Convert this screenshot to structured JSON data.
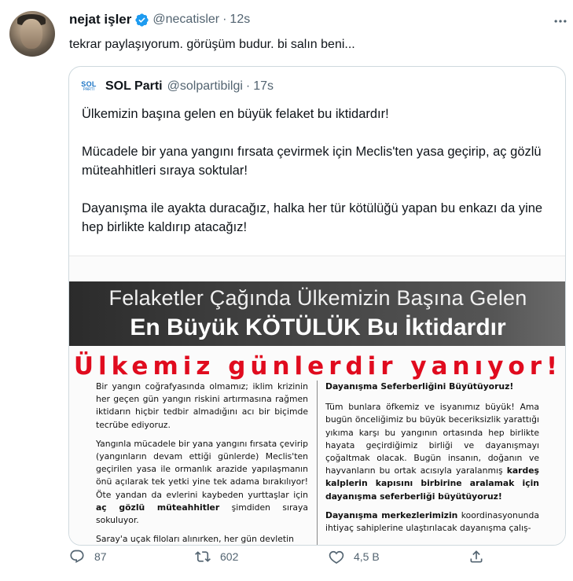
{
  "tweet": {
    "author_name": "nejat işler",
    "handle": "@necatisler",
    "separator": "·",
    "time": "12s",
    "text": "tekrar paylaşıyorum. görüşüm budur. bi salın beni...",
    "verified": true
  },
  "quote": {
    "logo_top": "SOL",
    "logo_bottom": "PARTİ",
    "author_name": "SOL Parti",
    "handle": "@solpartibilgi",
    "separator": "·",
    "time": "17s",
    "paragraphs": [
      "Ülkemizin başına gelen en büyük felaket bu iktidardır!",
      "Mücadele bir yana yangını fırsata çevirmek için Meclis'ten yasa geçirip, aç gözlü müteahhitleri sıraya soktular!",
      "Dayanışma ile ayakta duracağız, halka her tür kötülüğü yapan bu enkazı da yine hep birlikte kaldırıp atacağız!"
    ],
    "image": {
      "banner_line1": "Felaketler Çağında Ülkemizin Başına Gelen",
      "banner_line2": "En Büyük KÖTÜLÜK Bu İktidardır",
      "red_headline": "Ülkemiz günlerdir yanıyor!",
      "left_p1": "Bir yangın coğrafyasında olmamız; iklim krizinin her geçen gün yangın riskini artırmasına rağmen iktidarın hiçbir tedbir almadığını acı bir biçimde tecrübe ediyoruz.",
      "left_p2_a": "Yangınla mücadele bir yana yangını fırsata çevirip (yangınların devam ettiği günlerde) Meclis'ten geçirilen yasa ile ormanlık arazide yapılaşmanın önü açılarak tek yetki yine tek adama bırakılıyor! Öte yandan da evlerini kaybeden yurttaşlar için ",
      "left_p2_bold": "aç gözlü müteahhitler",
      "left_p2_b": " şimdiden sıraya sokuluyor.",
      "left_p3": "Saray'a uçak filoları alınırken, her gün devletin",
      "right_heading": "Dayanışma Seferberliğini Büyütüyoruz!",
      "right_p1_a": "Tüm bunlara öfkemiz ve isyanımız büyük! Ama bugün önceliğimiz bu büyük beceriksizlik yarattığı yıkıma karşı bu yangının ortasında hep birlikte hayata geçirdiğimiz birliği ve dayanışmayı çoğaltmak olacak. Bugün insanın, doğanın ve hayvanların bu ortak acısıyla yaralanmış ",
      "right_p1_bold": "kardeş kalplerin kapısını birbirine aralamak için dayanışma seferberliği büyütüyoruz!",
      "right_p2_bold": "Dayanışma merkezlerimizin",
      "right_p2_b": " koordinasyonunda ihtiyaç sahiplerine ulaştırılacak dayanışma çalış-"
    }
  },
  "actions": {
    "replies": "87",
    "retweets": "602",
    "likes": "4,5 B"
  },
  "icons": {
    "more": "more-dots-icon",
    "verified": "verified-badge-icon",
    "reply": "reply-icon",
    "retweet": "retweet-icon",
    "like": "heart-icon",
    "share": "share-icon"
  },
  "colors": {
    "verified_blue": "#1d9bf0",
    "muted_text": "#536471",
    "headline_red": "#e00b1e"
  }
}
